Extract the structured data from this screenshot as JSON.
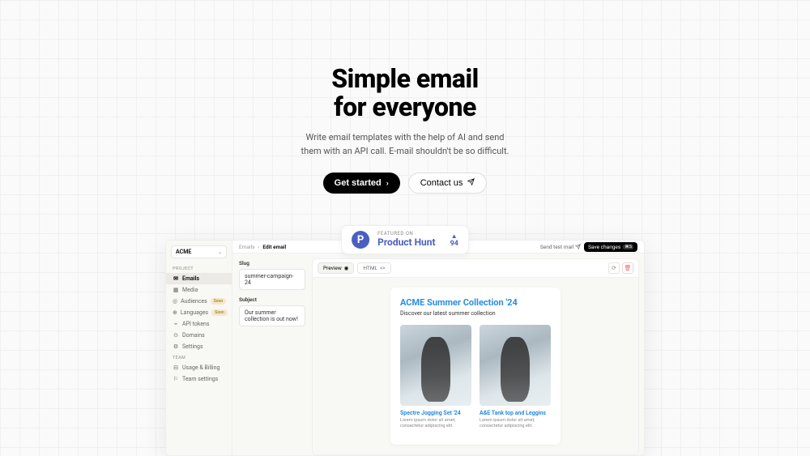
{
  "hero": {
    "title_line1": "Simple email",
    "title_line2": "for everyone",
    "subtitle": "Write email templates with the help of AI and send them with an API call. E-mail shouldn't be so difficult.",
    "cta_primary": "Get started",
    "cta_secondary": "Contact us"
  },
  "product_hunt": {
    "label": "FEATURED ON",
    "title": "Product Hunt",
    "votes": "94"
  },
  "app": {
    "workspace": "ACME",
    "sidebar": {
      "section_project": "PROJECT",
      "section_team": "TEAM",
      "items_project": [
        {
          "icon": "✉",
          "label": "Emails",
          "active": true
        },
        {
          "icon": "▦",
          "label": "Media"
        },
        {
          "icon": "◎",
          "label": "Audiences",
          "badge": "Soon"
        },
        {
          "icon": "⊕",
          "label": "Languages",
          "badge": "Soon"
        },
        {
          "icon": "⌁",
          "label": "API tokens"
        },
        {
          "icon": "⊙",
          "label": "Domains"
        },
        {
          "icon": "⚙",
          "label": "Settings"
        }
      ],
      "items_team": [
        {
          "icon": "⊟",
          "label": "Usage & Billing"
        },
        {
          "icon": "⚐",
          "label": "Team settings"
        }
      ]
    },
    "breadcrumbs": {
      "root": "Emails",
      "current": "Edit email"
    },
    "topbar": {
      "send_test": "Send test mail",
      "save": "Save changes",
      "save_kbd": "⌘S"
    },
    "form": {
      "slug_label": "Slug",
      "slug_value": "summer-campaign-24",
      "subject_label": "Subject",
      "subject_value": "Our summer collection is out now!"
    },
    "preview": {
      "tab_preview": "Preview",
      "tab_html": "HTML"
    },
    "email": {
      "title": "ACME Summer Collection '24",
      "subtitle": "Discover our latest summer collection",
      "products": [
        {
          "title": "Spectre Jogging Set '24",
          "text": "Lorem ipsum dolor sit amet, consectetur adipiscing elit."
        },
        {
          "title": "A&E Tank top and Leggins",
          "text": "Lorem ipsum dolor sit amet, consectetur adipiscing elit."
        }
      ]
    }
  }
}
